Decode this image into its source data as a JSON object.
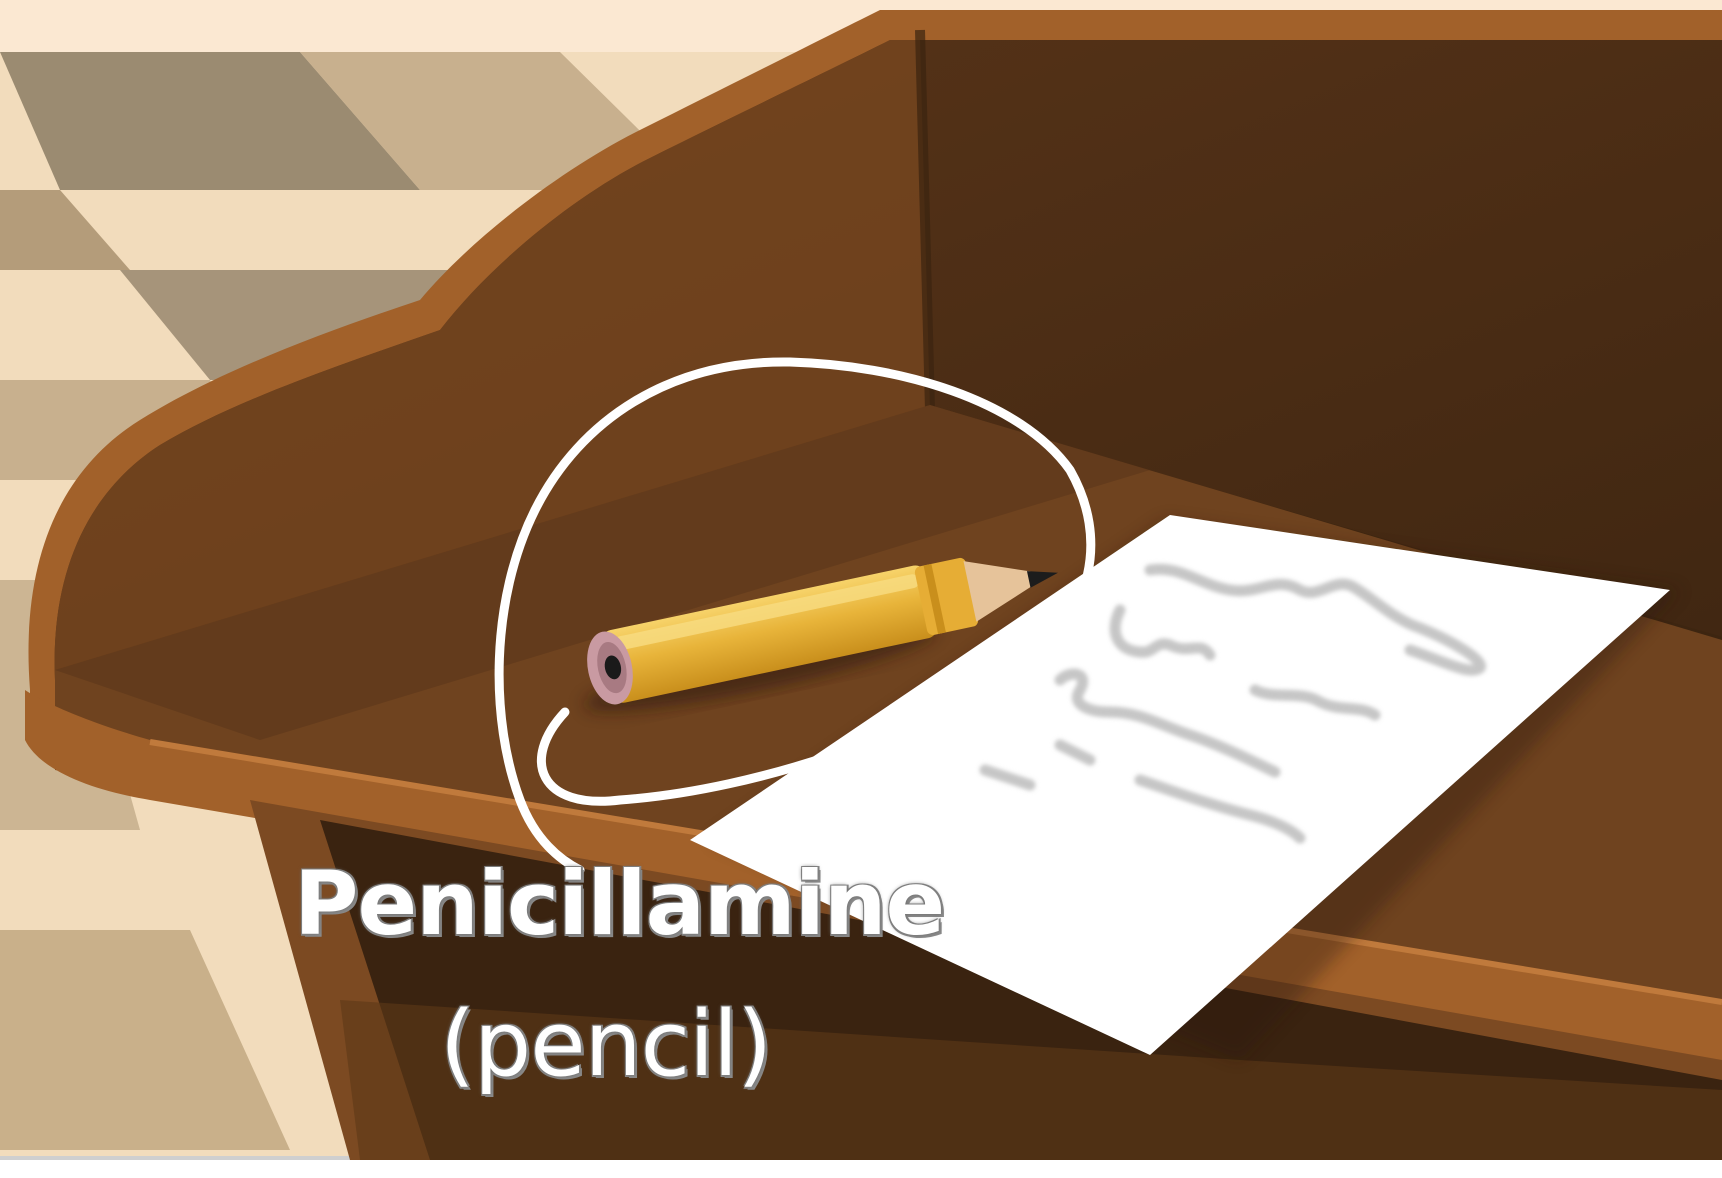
{
  "caption": {
    "drug_name": "Penicillamine",
    "mnemonic": "(pencil)"
  },
  "colors": {
    "backdrop_top": "#fbe8d2",
    "floor_light": "#f2dcbc",
    "floor_mid": "#c8b08e",
    "floor_dark": "#8c7c64",
    "desk_rim": "#9a5a28",
    "desk_shelf": "#6f431f",
    "desk_back": "#4e2f16",
    "desk_shadow": "#3a2310",
    "pencil_body": "#e8b43a",
    "pencil_highlight": "#f5cf62",
    "pencil_wood": "#e6c39a",
    "paper": "#ffffff",
    "scribble": "#c6c6c6",
    "highlight_ring": "#ffffff"
  },
  "icons": {
    "pencil": "pencil-icon",
    "paper": "paper-note",
    "ring": "circle-annotation"
  }
}
